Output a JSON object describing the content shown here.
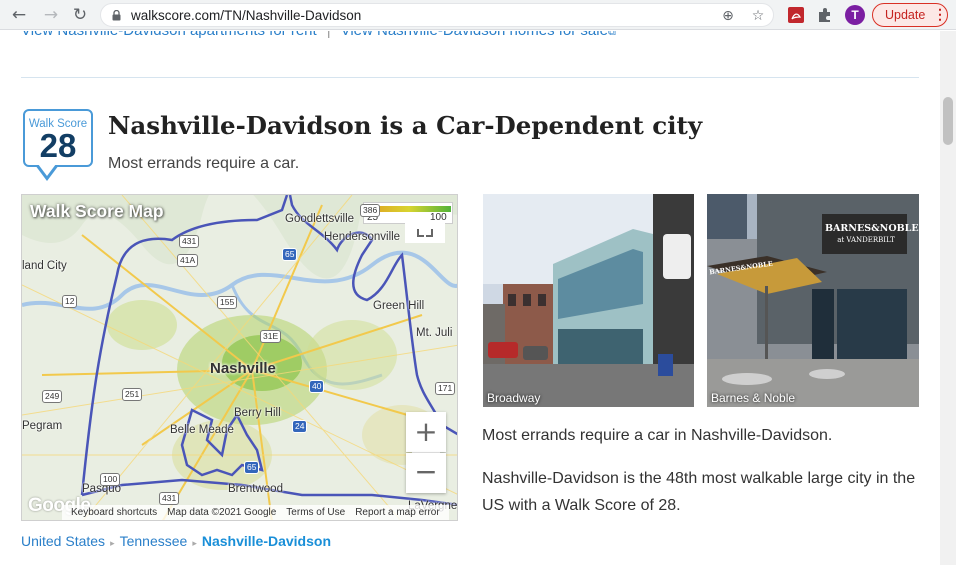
{
  "browser": {
    "url": "walkscore.com/TN/Nashville-Davidson",
    "update_label": "Update",
    "profile_initial": "T"
  },
  "top_links": {
    "apartments": "View Nashville-Davidson apartments for rent",
    "separator": "|",
    "homes": "View Nashville-Davidson homes for sale"
  },
  "badge": {
    "label": "Walk Score",
    "score": "28"
  },
  "headline": "Nashville-Davidson is a Car-Dependent city",
  "subline": "Most errands require a car.",
  "map": {
    "title": "Walk Score Map",
    "legend_low": "25",
    "legend_high": "100",
    "places": {
      "goodlettsville": "Goodlettsville",
      "hendersonville": "Hendersonville",
      "land_city": "land City",
      "green_hill": "Green Hill",
      "mt_juliet": "Mt. Juli",
      "nashville": "Nashville",
      "berry_hill": "Berry Hill",
      "belle_meade": "Belle Meade",
      "pegram": "Pegram",
      "pasquo": "Pasquo",
      "brentwood": "Brentwood",
      "la_vergne": "LaVergne"
    },
    "highways": {
      "h431a": "431",
      "h41a": "41A",
      "h12": "12",
      "h155": "155",
      "h31e": "31E",
      "h249": "249",
      "h251": "251",
      "h40": "40",
      "h24": "24",
      "h65a": "65",
      "h65b": "65",
      "h431b": "431",
      "h100": "100",
      "h171": "171",
      "h386": "386"
    },
    "zoom_in": "+",
    "zoom_out": "−",
    "google": "Google",
    "attribution": {
      "keyboard": "Keyboard shortcuts",
      "data": "Map data ©2021 Google",
      "terms": "Terms of Use",
      "report": "Report a map error"
    }
  },
  "breadcrumb": {
    "country": "United States",
    "state": "Tennessee",
    "city": "Nashville-Davidson"
  },
  "photos": [
    {
      "caption": "Broadway"
    },
    {
      "caption": "Barnes & Noble",
      "sign_top": "BARNES&NOBLE",
      "sign_bottom": "at VANDERBILT",
      "awning_text": "BARNES&NOBLE"
    }
  ],
  "description": {
    "p1": "Most errands require a car in Nashville-Davidson.",
    "p2": "Nashville-Davidson is the 48th most walkable large city in the US with a Walk Score of 28."
  },
  "colors": {
    "link": "#2a7fc9",
    "badge_border": "#4a9ad8",
    "badge_score": "#123e64",
    "boundary": "#4a55b8"
  }
}
